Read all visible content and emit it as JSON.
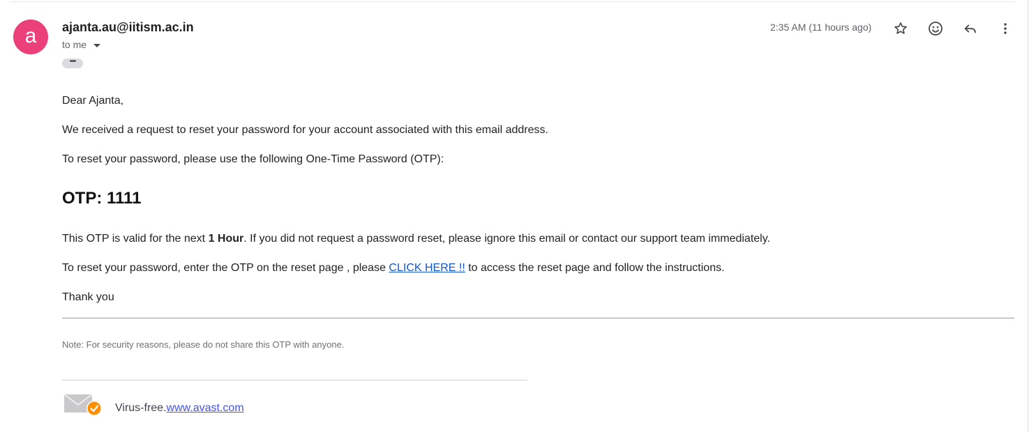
{
  "email": {
    "avatar_letter": "a",
    "avatar_color": "#ec407a",
    "sender": "ajanta.au@iitism.ac.in",
    "recipient_label": "to me",
    "trimmed_content_label": "•••",
    "timestamp": "2:35 AM (11 hours ago)",
    "actions": [
      {
        "name": "star-icon",
        "label": "Star"
      },
      {
        "name": "emoji-icon",
        "label": "Add reaction"
      },
      {
        "name": "reply-icon",
        "label": "Reply"
      },
      {
        "name": "more-vert-icon",
        "label": "More"
      }
    ]
  },
  "message": {
    "greeting": "Dear Ajanta,",
    "line1": "We received a request to reset your password for your account associated with this email address.",
    "line2": "To reset your password, please use the following One-Time Password (OTP):",
    "otp_heading": "OTP: 1111",
    "validity_pre": "This OTP is valid for the next ",
    "validity_bold": "1 Hour",
    "validity_post": ". If you did not request a password reset, please ignore this email or contact our support team immediately.",
    "reset_pre": "To reset your password, enter the OTP on the reset page , please ",
    "reset_link": "CLICK HERE !!",
    "reset_post": " to access the reset page and follow the instructions.",
    "closing": "Thank you",
    "note": "Note: For security reasons, please do not share this OTP with anyone."
  },
  "signature": {
    "virus_free_label": "Virus-free.",
    "avast_link": "www.avast.com",
    "link_color": "#4453ea",
    "badge_color": "#ff8f00"
  }
}
